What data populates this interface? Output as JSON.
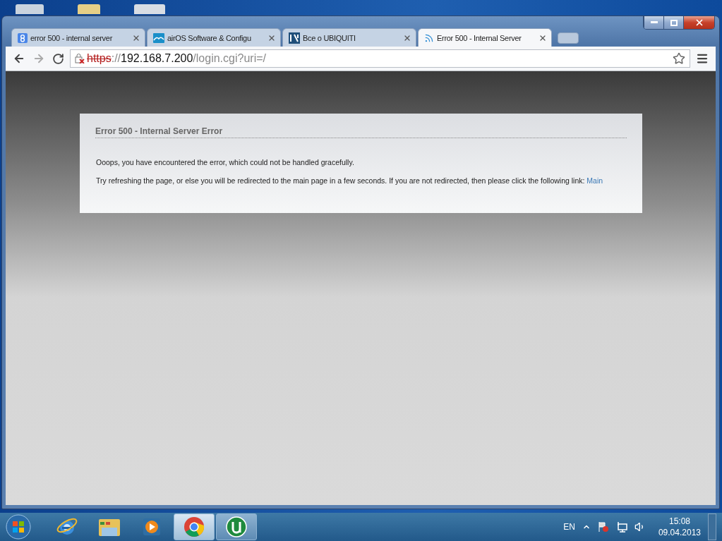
{
  "tabs": [
    {
      "title": "error 500 - internal server",
      "kind": "search",
      "selected": false
    },
    {
      "title": "airOS Software & Configu",
      "kind": "wave",
      "selected": false
    },
    {
      "title": "Все о UBIQUITI",
      "kind": "logo",
      "selected": false
    },
    {
      "title": "Error 500 - Internal Server",
      "kind": "feed",
      "selected": true
    }
  ],
  "address": {
    "insecure": true,
    "parts": [
      {
        "text": "https",
        "kind": "scheme"
      },
      {
        "text": "://",
        "kind": "dim"
      },
      {
        "text": "192.168.7.200",
        "kind": "host"
      },
      {
        "text": "/login.cgi?uri=/",
        "kind": "dim"
      }
    ]
  },
  "error_box": {
    "title": "Error 500 - Internal Server Error",
    "message": "Ooops, you have encountered the error, which could not be handled gracefully.",
    "hint": "Try refreshing the page, or else you will be redirected to the main page in a few seconds. If you are not redirected, then please click the following link:",
    "link": "Main"
  },
  "taskbar": {
    "apps": [
      {
        "kind": "ie",
        "running": false,
        "selected": false
      },
      {
        "kind": "explorer",
        "running": false,
        "selected": false
      },
      {
        "kind": "media",
        "running": false,
        "selected": false
      },
      {
        "kind": "chrome",
        "running": true,
        "selected": true
      },
      {
        "kind": "torrent",
        "running": true,
        "selected": false
      }
    ]
  },
  "tray": {
    "language": "EN",
    "time": "15:08",
    "date": "09.04.2013"
  }
}
